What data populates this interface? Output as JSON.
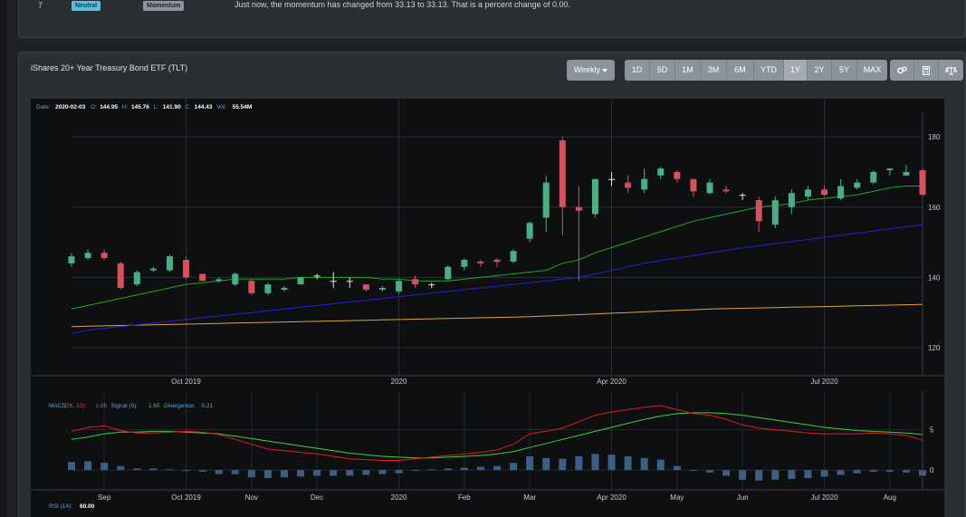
{
  "top_row": {
    "index": "7",
    "badge1": "Neutral",
    "badge2": "Momentum",
    "message": "Just now, the momentum has changed from 33.13 to 33.13. That is a percent change of 0.00."
  },
  "panel": {
    "title": "iShares 20+ Year Treasury Bond ETF (TLT)"
  },
  "toolbar": {
    "interval": "Weekly",
    "ranges": [
      "1D",
      "5D",
      "1M",
      "3M",
      "6M",
      "YTD",
      "1Y",
      "2Y",
      "5Y",
      "MAX"
    ],
    "active_range": "1Y",
    "tools": [
      "settings-icon",
      "calculator-icon",
      "compare-icon"
    ]
  },
  "info_bar": {
    "date_label": "Date:",
    "date": "2020-02-03",
    "o_label": "O:",
    "o": "144.95",
    "h_label": "H:",
    "h": "145.76",
    "l_label": "L:",
    "l": "141.90",
    "c_label": "C:",
    "c": "144.43",
    "vol_label": "Vol:",
    "vol": "55.54M"
  },
  "macd_label": {
    "name": "MACD",
    "params": "(26, 12):",
    "value": "1.86",
    "signal_label": "Signal (9):",
    "signal": "1.65",
    "div_label": "Divergence:",
    "div": "0.21"
  },
  "rsi_label": {
    "name": "RSI (14):",
    "value": "60.00"
  },
  "colors": {
    "up": "#4caf84",
    "down": "#d4525e",
    "sma_short": "#1ea81e",
    "sma_mid": "#2222d6",
    "sma_long": "#e0a23c",
    "macd": "#e01c1c",
    "signal": "#3ad13a",
    "hist": "#3d5f86"
  },
  "chart_data": [
    {
      "type": "candlestick",
      "y_ticks": [
        120,
        140,
        160,
        180
      ],
      "ylim": [
        112,
        187
      ],
      "x_ticks": [
        {
          "label": "Oct 2019",
          "i": 7
        },
        {
          "label": "2020",
          "i": 20
        },
        {
          "label": "Apr 2020",
          "i": 33
        },
        {
          "label": "Jul 2020",
          "i": 46
        }
      ],
      "candles": [
        {
          "o": 144,
          "h": 147,
          "l": 143,
          "c": 146
        },
        {
          "o": 145.5,
          "h": 148,
          "l": 145,
          "c": 147
        },
        {
          "o": 147,
          "h": 148,
          "l": 145,
          "c": 145.5
        },
        {
          "o": 144,
          "h": 144.5,
          "l": 136.5,
          "c": 137
        },
        {
          "o": 138,
          "h": 142,
          "l": 137.5,
          "c": 141.5
        },
        {
          "o": 142,
          "h": 143,
          "l": 141.5,
          "c": 142.5
        },
        {
          "o": 142,
          "h": 146.5,
          "l": 141.5,
          "c": 146
        },
        {
          "o": 145,
          "h": 146,
          "l": 139.5,
          "c": 140
        },
        {
          "o": 141,
          "h": 141,
          "l": 139,
          "c": 139
        },
        {
          "o": 139,
          "h": 140,
          "l": 138.5,
          "c": 139.5
        },
        {
          "o": 138,
          "h": 141.5,
          "l": 137.5,
          "c": 141
        },
        {
          "o": 139,
          "h": 139.5,
          "l": 135,
          "c": 135.5
        },
        {
          "o": 135.5,
          "h": 138.5,
          "l": 135,
          "c": 138
        },
        {
          "o": 136.5,
          "h": 137.5,
          "l": 136,
          "c": 137
        },
        {
          "o": 138,
          "h": 140,
          "l": 138,
          "c": 140
        },
        {
          "o": 140.5,
          "h": 141,
          "l": 139.5,
          "c": 140.5
        },
        {
          "o": 139,
          "h": 141.5,
          "l": 137,
          "c": 139
        },
        {
          "o": 139,
          "h": 140,
          "l": 137,
          "c": 139
        },
        {
          "o": 138,
          "h": 138,
          "l": 136,
          "c": 136.5
        },
        {
          "o": 136.5,
          "h": 137.5,
          "l": 136,
          "c": 137
        },
        {
          "o": 136,
          "h": 139.5,
          "l": 135.5,
          "c": 139
        },
        {
          "o": 139.5,
          "h": 140.5,
          "l": 137,
          "c": 138
        },
        {
          "o": 138,
          "h": 138.5,
          "l": 137,
          "c": 138
        },
        {
          "o": 139.5,
          "h": 143.5,
          "l": 139,
          "c": 143
        },
        {
          "o": 143,
          "h": 145.5,
          "l": 142,
          "c": 145
        },
        {
          "o": 144.5,
          "h": 145,
          "l": 143,
          "c": 144
        },
        {
          "o": 145,
          "h": 145.5,
          "l": 143,
          "c": 144.43
        },
        {
          "o": 144.5,
          "h": 148,
          "l": 144,
          "c": 147.5
        },
        {
          "o": 151,
          "h": 156,
          "l": 150,
          "c": 155.5
        },
        {
          "o": 157,
          "h": 169,
          "l": 153,
          "c": 167
        },
        {
          "o": 179,
          "h": 180,
          "l": 152,
          "c": 160
        },
        {
          "o": 160,
          "h": 166,
          "l": 139,
          "c": 159
        },
        {
          "o": 158,
          "h": 168,
          "l": 157,
          "c": 168
        },
        {
          "o": 168,
          "h": 170,
          "l": 166,
          "c": 168
        },
        {
          "o": 167,
          "h": 169,
          "l": 164,
          "c": 165.5
        },
        {
          "o": 165,
          "h": 171,
          "l": 164,
          "c": 168
        },
        {
          "o": 169,
          "h": 171.5,
          "l": 168,
          "c": 171
        },
        {
          "o": 170,
          "h": 170.5,
          "l": 167,
          "c": 168
        },
        {
          "o": 168,
          "h": 168,
          "l": 163,
          "c": 164.5
        },
        {
          "o": 164,
          "h": 168,
          "l": 163.5,
          "c": 167
        },
        {
          "o": 165,
          "h": 166,
          "l": 164,
          "c": 164.5
        },
        {
          "o": 163.5,
          "h": 164,
          "l": 162,
          "c": 163.5
        },
        {
          "o": 162,
          "h": 163,
          "l": 153,
          "c": 156
        },
        {
          "o": 155,
          "h": 163,
          "l": 154,
          "c": 162
        },
        {
          "o": 160,
          "h": 165,
          "l": 158,
          "c": 164
        },
        {
          "o": 163,
          "h": 166,
          "l": 162,
          "c": 165
        },
        {
          "o": 165,
          "h": 166,
          "l": 163,
          "c": 163.5
        },
        {
          "o": 162.5,
          "h": 168,
          "l": 162,
          "c": 166
        },
        {
          "o": 165.5,
          "h": 168,
          "l": 165,
          "c": 167
        },
        {
          "o": 167,
          "h": 170.5,
          "l": 166.5,
          "c": 170
        },
        {
          "o": 170.5,
          "h": 171,
          "l": 169,
          "c": 171
        },
        {
          "o": 169,
          "h": 172,
          "l": 169,
          "c": 170
        },
        {
          "o": 170.5,
          "h": 171,
          "l": 163,
          "c": 163.5
        }
      ],
      "sma_short": [
        131,
        132,
        133,
        134,
        135,
        136,
        137,
        138,
        138.5,
        139,
        139.5,
        139.5,
        139.5,
        139.5,
        140,
        140,
        140,
        140,
        140,
        139.5,
        139.5,
        139,
        139,
        139,
        139.5,
        140,
        140.5,
        141,
        141.5,
        142,
        144,
        145,
        147,
        148.5,
        150,
        151.5,
        153,
        154.5,
        156,
        157,
        158,
        159,
        160,
        160.5,
        161,
        162,
        162.5,
        163,
        163.5,
        164.5,
        165.5,
        166,
        166
      ],
      "sma_mid": [
        124,
        125,
        125.5,
        126,
        126.5,
        127,
        127.5,
        128,
        128.5,
        129,
        129.5,
        130,
        130.5,
        131,
        131.5,
        132,
        132.5,
        133,
        133.5,
        134,
        134.5,
        135,
        135.5,
        136,
        136.5,
        137,
        137.5,
        138,
        138.5,
        139,
        139.5,
        140,
        141,
        142,
        143,
        144,
        144.8,
        145.5,
        146.2,
        147,
        147.7,
        148.4,
        149,
        149.6,
        150.2,
        150.8,
        151.4,
        152,
        152.6,
        153.2,
        153.8,
        154.4,
        155
      ],
      "sma_long": [
        126,
        126.1,
        126.2,
        126.3,
        126.4,
        126.5,
        126.6,
        126.7,
        126.8,
        126.9,
        127,
        127.1,
        127.2,
        127.3,
        127.4,
        127.5,
        127.6,
        127.7,
        127.8,
        127.9,
        128,
        128.1,
        128.2,
        128.3,
        128.4,
        128.5,
        128.6,
        128.7,
        128.8,
        129,
        129.2,
        129.4,
        129.6,
        129.8,
        130,
        130.2,
        130.4,
        130.6,
        130.8,
        131,
        131.1,
        131.2,
        131.3,
        131.4,
        131.5,
        131.6,
        131.7,
        131.8,
        131.9,
        132,
        132.1,
        132.2,
        132.3
      ]
    },
    {
      "type": "macd",
      "y_ticks": [
        0,
        5
      ],
      "ylim": [
        -2,
        9
      ],
      "x_ticks": [
        {
          "label": "Sep",
          "i": 2
        },
        {
          "label": "Oct 2019",
          "i": 7
        },
        {
          "label": "Nov",
          "i": 11
        },
        {
          "label": "Dec",
          "i": 15
        },
        {
          "label": "2020",
          "i": 20
        },
        {
          "label": "Feb",
          "i": 24
        },
        {
          "label": "Mar",
          "i": 28
        },
        {
          "label": "Apr 2020",
          "i": 33
        },
        {
          "label": "May",
          "i": 37
        },
        {
          "label": "Jun",
          "i": 41
        },
        {
          "label": "Jul 2020",
          "i": 46
        },
        {
          "label": "Aug",
          "i": 50
        }
      ],
      "macd": [
        4.8,
        5.3,
        5.5,
        4.9,
        4.6,
        4.6,
        4.7,
        4.8,
        4.7,
        4.4,
        3.8,
        3.2,
        2.6,
        2.4,
        2.2,
        2.0,
        1.7,
        1.4,
        1.3,
        1.2,
        1.2,
        1.4,
        1.6,
        1.8,
        2.0,
        2.2,
        2.5,
        3.2,
        4.5,
        4.8,
        5.2,
        6.0,
        6.8,
        7.2,
        7.5,
        7.8,
        8.0,
        7.5,
        7.0,
        6.8,
        6.3,
        5.6,
        5.2,
        5.0,
        4.8,
        4.6,
        4.5,
        4.5,
        4.5,
        4.6,
        4.5,
        4.3,
        3.7
      ],
      "signal": [
        3.8,
        4.1,
        4.5,
        4.7,
        4.7,
        4.8,
        4.8,
        4.7,
        4.6,
        4.5,
        4.2,
        3.9,
        3.6,
        3.3,
        3.0,
        2.7,
        2.4,
        2.1,
        1.9,
        1.7,
        1.6,
        1.5,
        1.5,
        1.6,
        1.7,
        1.8,
        2.0,
        2.3,
        2.8,
        3.3,
        3.8,
        4.3,
        4.8,
        5.3,
        5.8,
        6.3,
        6.7,
        7.0,
        7.1,
        7.1,
        7.0,
        6.8,
        6.5,
        6.2,
        5.9,
        5.6,
        5.3,
        5.1,
        4.9,
        4.8,
        4.7,
        4.6,
        4.4
      ],
      "histogram": [
        1.0,
        1.1,
        0.9,
        0.5,
        0.2,
        0.2,
        0.1,
        -0.1,
        -0.2,
        -0.5,
        -0.5,
        -0.9,
        -1.0,
        -0.9,
        -0.8,
        -0.7,
        -0.7,
        -0.7,
        -0.6,
        -0.5,
        -0.4,
        -0.1,
        0.1,
        0.2,
        0.3,
        0.4,
        0.5,
        0.9,
        1.7,
        1.5,
        1.4,
        1.7,
        2.0,
        1.9,
        1.7,
        1.5,
        1.3,
        0.5,
        -0.1,
        -0.3,
        -0.7,
        -1.2,
        -1.3,
        -1.2,
        -1.1,
        -1.0,
        -0.8,
        -0.6,
        -0.4,
        -0.2,
        -0.2,
        -0.3,
        -0.7
      ]
    }
  ]
}
